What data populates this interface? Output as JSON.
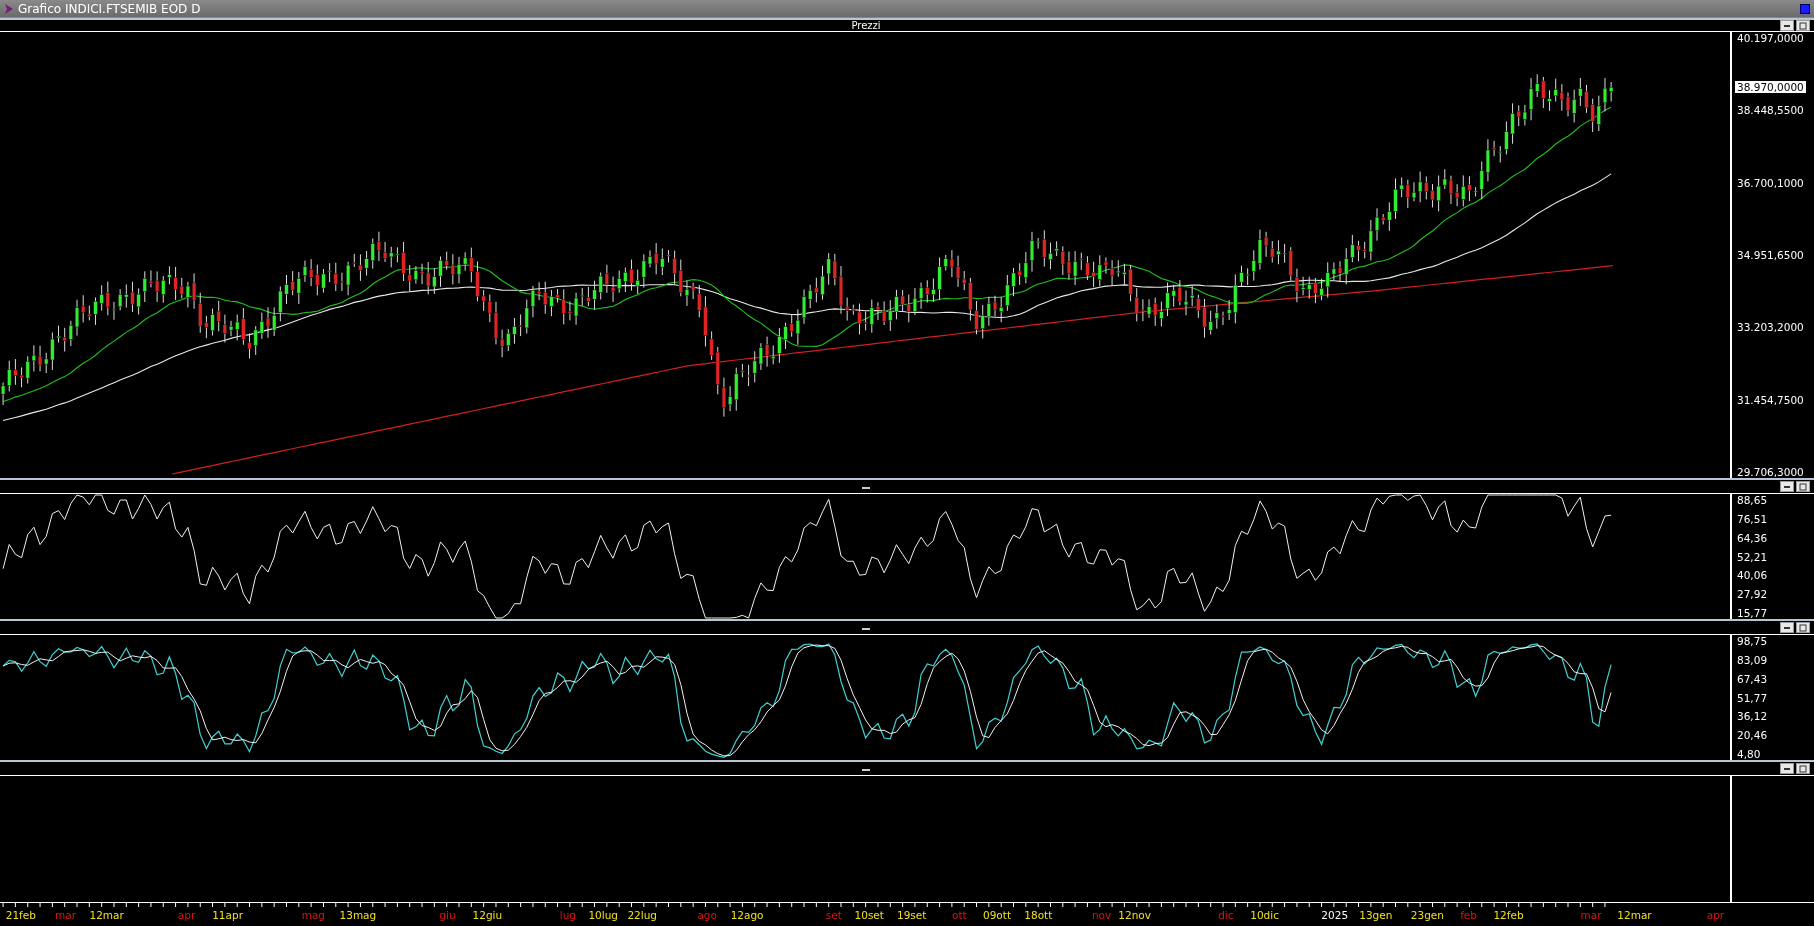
{
  "window": {
    "title": "Grafico INDICI.FTSEMIB EOD D"
  },
  "panels": [
    {
      "kind": "price",
      "title": "Prezzi",
      "axis_labels": [
        "40.197,0000",
        "38.448,5500",
        "36.700,1000",
        "34.951,6500",
        "33.203,2000",
        "31.454,7500",
        "29.706,3000"
      ],
      "current_price": "38.970,0000"
    },
    {
      "kind": "rsi",
      "axis_labels": [
        "88,65",
        "76,51",
        "64,36",
        "52,21",
        "40,06",
        "27,92",
        "15,77"
      ]
    },
    {
      "kind": "stochastic",
      "axis_labels": [
        "98,75",
        "83,09",
        "67,43",
        "51,77",
        "36,12",
        "20,46",
        "4,80"
      ]
    },
    {
      "kind": "empty"
    }
  ],
  "date_axis": {
    "labels": [
      {
        "text": "21feb",
        "kind": "day"
      },
      {
        "text": "mar",
        "kind": "month"
      },
      {
        "text": "12mar",
        "kind": "day"
      },
      {
        "text": "apr",
        "kind": "month"
      },
      {
        "text": "11apr",
        "kind": "day"
      },
      {
        "text": "mag",
        "kind": "month"
      },
      {
        "text": "13mag",
        "kind": "day"
      },
      {
        "text": "giu",
        "kind": "month"
      },
      {
        "text": "12giu",
        "kind": "day"
      },
      {
        "text": "lug",
        "kind": "month"
      },
      {
        "text": "10lug",
        "kind": "day"
      },
      {
        "text": "22lug",
        "kind": "day"
      },
      {
        "text": "ago",
        "kind": "month"
      },
      {
        "text": "12ago",
        "kind": "day"
      },
      {
        "text": "set",
        "kind": "month"
      },
      {
        "text": "10set",
        "kind": "day"
      },
      {
        "text": "19set",
        "kind": "day"
      },
      {
        "text": "ott",
        "kind": "month"
      },
      {
        "text": "09ott",
        "kind": "day"
      },
      {
        "text": "18ott",
        "kind": "day"
      },
      {
        "text": "nov",
        "kind": "month"
      },
      {
        "text": "12nov",
        "kind": "day"
      },
      {
        "text": "dic",
        "kind": "month"
      },
      {
        "text": "10dic",
        "kind": "day"
      },
      {
        "text": "2025",
        "kind": "year"
      },
      {
        "text": "13gen",
        "kind": "day"
      },
      {
        "text": "23gen",
        "kind": "day"
      },
      {
        "text": "feb",
        "kind": "month"
      },
      {
        "text": "12feb",
        "kind": "day"
      },
      {
        "text": "mar",
        "kind": "month"
      },
      {
        "text": "12mar",
        "kind": "day"
      },
      {
        "text": "apr",
        "kind": "month"
      }
    ]
  }
}
